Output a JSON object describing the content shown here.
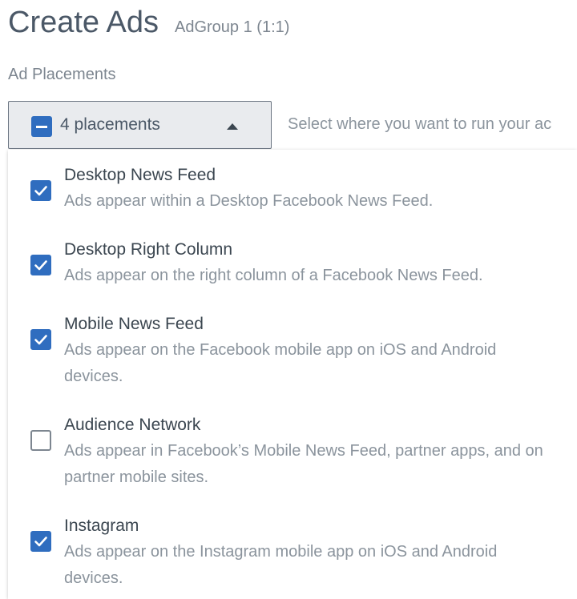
{
  "header": {
    "title": "Create Ads",
    "subtitle": "AdGroup 1 (1:1)"
  },
  "placements": {
    "section_label": "Ad Placements",
    "dropdown_label": "4 placements",
    "hint": "Select where you want to run your ac",
    "options": [
      {
        "title": "Desktop News Feed",
        "description": "Ads appear within a Desktop Facebook News Feed.",
        "checked": true
      },
      {
        "title": "Desktop Right Column",
        "description": "Ads appear on the right column of a Facebook News Feed.",
        "checked": true
      },
      {
        "title": "Mobile News Feed",
        "description": "Ads appear on the Facebook mobile app on iOS and Android devices.",
        "checked": true
      },
      {
        "title": "Audience Network",
        "description": "Ads appear in Facebook’s Mobile News Feed, partner apps, and on partner mobile sites.",
        "checked": false
      },
      {
        "title": "Instagram",
        "description": "Ads appear on the Instagram mobile app on iOS and Android devices.",
        "checked": true
      }
    ]
  },
  "colors": {
    "accent": "#2f6dbf",
    "text": "#3b4650",
    "muted": "#8b949d"
  }
}
